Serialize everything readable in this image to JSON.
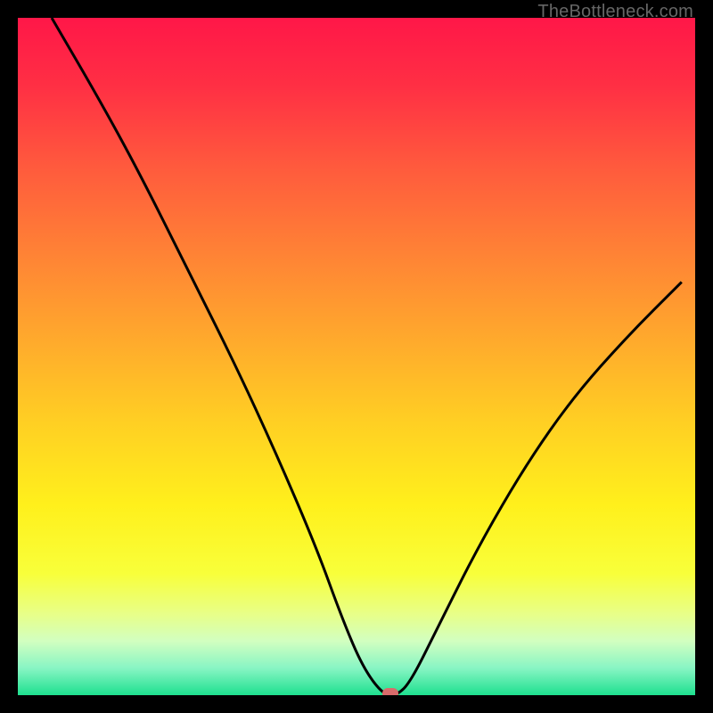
{
  "watermark": "TheBottleneck.com",
  "chart_data": {
    "type": "line",
    "title": "",
    "xlabel": "",
    "ylabel": "",
    "xlim": [
      0,
      100
    ],
    "ylim": [
      0,
      100
    ],
    "grid": false,
    "legend": false,
    "series": [
      {
        "name": "bottleneck-curve",
        "x": [
          5,
          12,
          18,
          25,
          32,
          38,
          44,
          48,
          51,
          54,
          56,
          58,
          62,
          68,
          75,
          82,
          90,
          98
        ],
        "y": [
          100,
          88,
          77,
          63,
          49,
          36,
          22,
          11,
          4,
          0,
          0,
          2,
          10,
          22,
          34,
          44,
          53,
          61
        ]
      }
    ],
    "marker": {
      "name": "optimal-point",
      "x": 55,
      "y": 0,
      "color": "#d86b6b"
    },
    "background_gradient_stops": [
      {
        "offset": 0.0,
        "color": "#ff1748"
      },
      {
        "offset": 0.1,
        "color": "#ff2f44"
      },
      {
        "offset": 0.22,
        "color": "#ff5a3d"
      },
      {
        "offset": 0.35,
        "color": "#ff8335"
      },
      {
        "offset": 0.48,
        "color": "#ffab2c"
      },
      {
        "offset": 0.6,
        "color": "#ffd023"
      },
      {
        "offset": 0.72,
        "color": "#fff01c"
      },
      {
        "offset": 0.82,
        "color": "#f8ff3a"
      },
      {
        "offset": 0.88,
        "color": "#e8ff88"
      },
      {
        "offset": 0.92,
        "color": "#d2ffc0"
      },
      {
        "offset": 0.96,
        "color": "#88f5c4"
      },
      {
        "offset": 1.0,
        "color": "#1ee08f"
      }
    ]
  }
}
